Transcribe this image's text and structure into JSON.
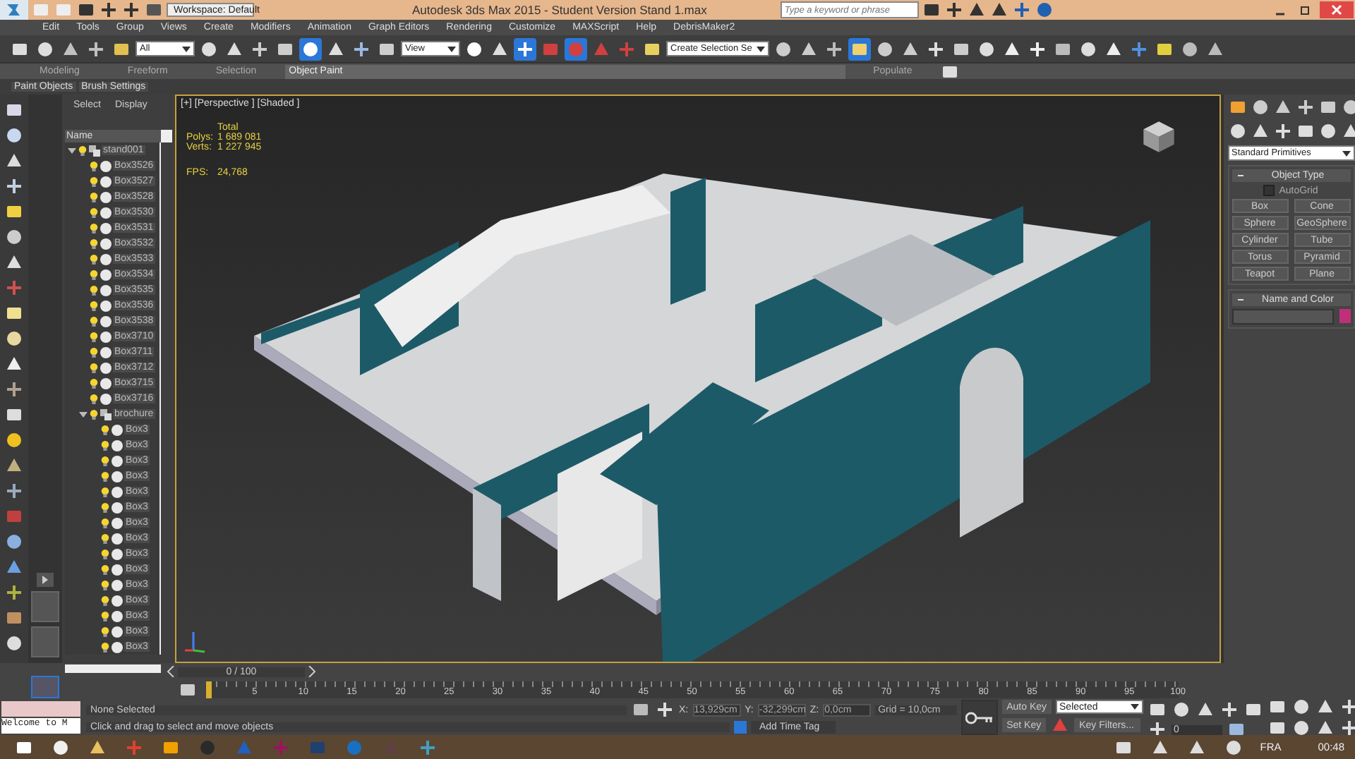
{
  "title_bar": {
    "workspace": "Workspace: Default",
    "title": "Autodesk 3ds Max  2015  - Student Version   Stand 1.max",
    "search_placeholder": "Type a keyword or phrase"
  },
  "menu": [
    "Edit",
    "Tools",
    "Group",
    "Views",
    "Create",
    "Modifiers",
    "Animation",
    "Graph Editors",
    "Rendering",
    "Customize",
    "MAXScript",
    "Help",
    "DebrisMaker2"
  ],
  "toolbar": [
    {
      "kind": "button",
      "on": false
    },
    {
      "kind": "button",
      "on": false
    },
    {
      "kind": "button",
      "on": false
    },
    {
      "kind": "button",
      "on": false
    },
    {
      "kind": "button",
      "on": false
    },
    {
      "kind": "dropdown",
      "value": "All"
    },
    {
      "kind": "button",
      "on": false
    },
    {
      "kind": "button",
      "on": false
    },
    {
      "kind": "button",
      "on": false
    },
    {
      "kind": "button",
      "on": false
    },
    {
      "kind": "button",
      "on": true
    },
    {
      "kind": "button",
      "on": false
    },
    {
      "kind": "button",
      "on": false
    },
    {
      "kind": "button",
      "on": false
    },
    {
      "kind": "dropdown",
      "value": "View"
    },
    {
      "kind": "button",
      "on": false
    },
    {
      "kind": "button",
      "on": false
    },
    {
      "kind": "button",
      "on": true
    },
    {
      "kind": "button",
      "on": false
    },
    {
      "kind": "button",
      "on": true
    },
    {
      "kind": "button",
      "on": false
    },
    {
      "kind": "button",
      "on": false
    },
    {
      "kind": "button",
      "on": false
    },
    {
      "kind": "dropdown",
      "value": "Create Selection Se"
    },
    {
      "kind": "button",
      "on": false
    },
    {
      "kind": "button",
      "on": false
    },
    {
      "kind": "button",
      "on": false
    },
    {
      "kind": "button",
      "on": true
    },
    {
      "kind": "button",
      "on": false
    },
    {
      "kind": "button",
      "on": false
    },
    {
      "kind": "button",
      "on": false
    },
    {
      "kind": "button",
      "on": false
    },
    {
      "kind": "button",
      "on": false
    },
    {
      "kind": "button",
      "on": false
    },
    {
      "kind": "button",
      "on": false
    },
    {
      "kind": "button",
      "on": false
    },
    {
      "kind": "button",
      "on": false
    },
    {
      "kind": "button",
      "on": false
    },
    {
      "kind": "button",
      "on": false
    },
    {
      "kind": "button",
      "on": false
    },
    {
      "kind": "button",
      "on": false
    },
    {
      "kind": "button",
      "on": false
    }
  ],
  "ribbon": {
    "tabs": [
      {
        "label": "Modeling",
        "selected": false
      },
      {
        "label": "Freeform",
        "selected": false
      },
      {
        "label": "Selection",
        "selected": false
      },
      {
        "label": "Object Paint",
        "selected": true
      },
      {
        "label": "Populate",
        "selected": false
      }
    ],
    "panels": [
      "Paint Objects",
      "Brush Settings"
    ]
  },
  "scene_explorer": {
    "tabs": [
      "Select",
      "Display"
    ],
    "column": "Name",
    "tree": [
      {
        "name": "stand001",
        "kind": "group",
        "expanded": true,
        "children": [
          {
            "name": "Box3526",
            "kind": "object"
          },
          {
            "name": "Box3527",
            "kind": "object"
          },
          {
            "name": "Box3528",
            "kind": "object"
          },
          {
            "name": "Box3530",
            "kind": "object"
          },
          {
            "name": "Box3531",
            "kind": "object"
          },
          {
            "name": "Box3532",
            "kind": "object"
          },
          {
            "name": "Box3533",
            "kind": "object"
          },
          {
            "name": "Box3534",
            "kind": "object"
          },
          {
            "name": "Box3535",
            "kind": "object"
          },
          {
            "name": "Box3536",
            "kind": "object"
          },
          {
            "name": "Box3538",
            "kind": "object"
          },
          {
            "name": "Box3710",
            "kind": "object"
          },
          {
            "name": "Box3711",
            "kind": "object"
          },
          {
            "name": "Box3712",
            "kind": "object"
          },
          {
            "name": "Box3715",
            "kind": "object"
          },
          {
            "name": "Box3716",
            "kind": "object"
          },
          {
            "name": "brochure",
            "kind": "group",
            "expanded": true,
            "children": [
              {
                "name": "Box3",
                "kind": "object"
              },
              {
                "name": "Box3",
                "kind": "object"
              },
              {
                "name": "Box3",
                "kind": "object"
              },
              {
                "name": "Box3",
                "kind": "object"
              },
              {
                "name": "Box3",
                "kind": "object"
              },
              {
                "name": "Box3",
                "kind": "object"
              },
              {
                "name": "Box3",
                "kind": "object"
              },
              {
                "name": "Box3",
                "kind": "object"
              },
              {
                "name": "Box3",
                "kind": "object"
              },
              {
                "name": "Box3",
                "kind": "object"
              },
              {
                "name": "Box3",
                "kind": "object"
              },
              {
                "name": "Box3",
                "kind": "object"
              },
              {
                "name": "Box3",
                "kind": "object"
              },
              {
                "name": "Box3",
                "kind": "object"
              },
              {
                "name": "Box3",
                "kind": "object"
              }
            ]
          }
        ]
      }
    ]
  },
  "viewport": {
    "label": "[+] [Perspective ] [Shaded ]",
    "stats_heading": "Total",
    "stats": [
      {
        "label": "Polys:",
        "value": "1 689 081"
      },
      {
        "label": "Verts:",
        "value": "1 227 945"
      },
      {
        "label": "FPS:",
        "value": "24,768"
      }
    ]
  },
  "command_panel": {
    "dropdown": "Standard Primitives",
    "object_type": {
      "title": "Object Type",
      "autogrid": {
        "label": "AutoGrid",
        "checked": false
      },
      "buttons": [
        "Box",
        "Cone",
        "Sphere",
        "GeoSphere",
        "Cylinder",
        "Tube",
        "Torus",
        "Pyramid",
        "Teapot",
        "Plane"
      ]
    },
    "name_and_color": {
      "title": "Name and Color",
      "color": "#c0307a"
    }
  },
  "timeline": {
    "frame": "0 / 100",
    "ticks": [
      "5",
      "10",
      "15",
      "20",
      "25",
      "30",
      "35",
      "40",
      "45",
      "50",
      "55",
      "60",
      "65",
      "70",
      "75",
      "80",
      "85",
      "90",
      "95",
      "100"
    ]
  },
  "status": {
    "listener": "Welcome to M",
    "selection": "None Selected",
    "prompt": "Click and drag to select and move objects",
    "x_label": "X:",
    "x": "13,929cm",
    "y_label": "Y:",
    "y": "-32,299cm",
    "z_label": "Z:",
    "z": "0,0cm",
    "grid": "Grid = 10,0cm",
    "add_time_tag": "Add Time Tag",
    "auto_key": "Auto Key",
    "set_key": "Set Key",
    "key_mode": "Selected",
    "key_filters": "Key Filters...",
    "current_frame": "0"
  },
  "taskbar": {
    "language": "FRA",
    "time": "00:48"
  }
}
